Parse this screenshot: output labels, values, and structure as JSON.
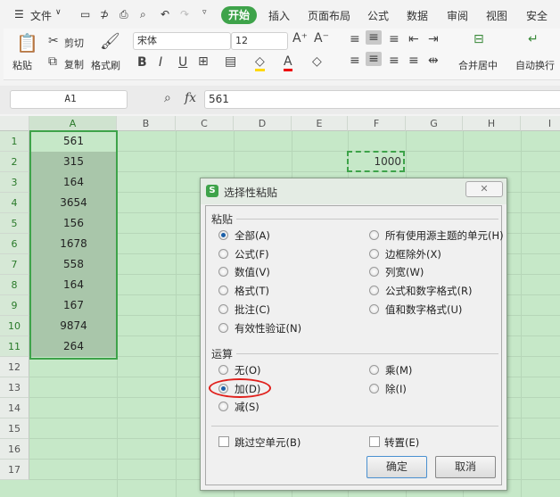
{
  "menubar": {
    "file": "文件",
    "tabs": [
      "开始",
      "插入",
      "页面布局",
      "公式",
      "数据",
      "审阅",
      "视图",
      "安全"
    ]
  },
  "ribbon": {
    "paste": "粘贴",
    "cut": "剪切",
    "copy": "复制",
    "format_painter": "格式刷",
    "font_name": "宋体",
    "font_size": "12",
    "merge_center": "合并居中",
    "wrap_text": "自动换行"
  },
  "formula_bar": {
    "cell_ref": "A1",
    "fx": "fx",
    "value": "561"
  },
  "sheet": {
    "columns": [
      "A",
      "B",
      "C",
      "D",
      "E",
      "F",
      "G",
      "H",
      "I"
    ],
    "rows": [
      "1",
      "2",
      "3",
      "4",
      "5",
      "6",
      "7",
      "8",
      "9",
      "10",
      "11",
      "12",
      "13",
      "14",
      "15",
      "16",
      "17"
    ],
    "colA": [
      "561",
      "315",
      "164",
      "3654",
      "156",
      "1678",
      "558",
      "164",
      "167",
      "9874",
      "264"
    ],
    "F2": "1000"
  },
  "dialog": {
    "title": "选择性粘贴",
    "paste_group": "粘贴",
    "paste_left": [
      "全部(A)",
      "公式(F)",
      "数值(V)",
      "格式(T)",
      "批注(C)",
      "有效性验证(N)"
    ],
    "paste_right": [
      "所有使用源主题的单元(H)",
      "边框除外(X)",
      "列宽(W)",
      "公式和数字格式(R)",
      "值和数字格式(U)"
    ],
    "op_group": "运算",
    "op_left": [
      "无(O)",
      "加(D)",
      "减(S)"
    ],
    "op_right": [
      "乘(M)",
      "除(I)"
    ],
    "skip_blanks": "跳过空单元(B)",
    "transpose": "转置(E)",
    "ok": "确定",
    "cancel": "取消",
    "close": "✕"
  },
  "colors": {
    "accent": "#3ea34a",
    "highlight": "#e0201c"
  }
}
